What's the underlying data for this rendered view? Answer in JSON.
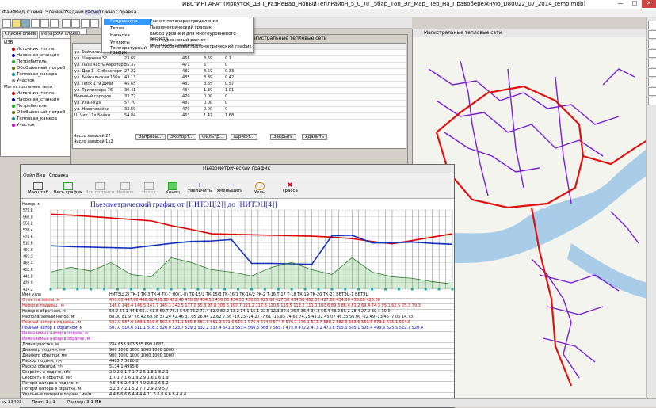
{
  "window": {
    "title": "ИВС\"ИНГАРА\" (Иркутск_ДЗП_РазНеВао_НовыйТеплРайон_5_0_ЛГ_5бар_Топ_Эл_Мар_Пер_На_Правобережную_D80022_07_2014_temp.mdb)"
  },
  "menu": [
    "Файл",
    "Вид",
    "Схема",
    "Элемент",
    "Задачи",
    "Расчет",
    "Окно",
    "Справка"
  ],
  "dropdown": {
    "items": [
      "Гидравлика",
      "Тепло",
      "Наладка",
      "Утилиты",
      "Температурный график"
    ],
    "submenu": [
      "Расчет потокораспределения",
      "Пьезометрический график",
      "Выбор уровней для многоуровневого расчета",
      "Многоуровневый расчет потокораспределения",
      "Многоуровневый пьезометрический график"
    ]
  },
  "leftpanel": {
    "tabs": [
      "Список слоев",
      "Иерархия слоев"
    ],
    "tree": [
      "ИЗВ",
      "Источник_тепла",
      "Насосная_станция",
      "Потребитель",
      "Обобщенный_потреб",
      "Тепловая_камера",
      "Участок",
      "Магистральные тепл",
      "Источник_тепла",
      "Насосная_станция",
      "Потребитель",
      "Обобщенный_потреб",
      "Тепловая_камера",
      "Участок"
    ]
  },
  "tablewin": {
    "title": "Магистральные тепловые сети",
    "rows": [
      [
        "ул. Байкальская 235",
        "10.62",
        "483",
        "3.81",
        "2.67"
      ],
      [
        "ул. Ширяева 32",
        "23.69",
        "468",
        "3.69",
        "0.1"
      ],
      [
        "ул. Лазо часть Аэропорт",
        "35.37",
        "471",
        "5",
        "0"
      ],
      [
        "ул. Дор 1 - Сибэкспорт",
        "27.22",
        "482",
        "4.59",
        "0.33"
      ],
      [
        "ул. Байкальская 166а",
        "43.13",
        "485",
        "3.89",
        "0.42"
      ],
      [
        "ул. Писк 179 Дичи",
        "45.65",
        "487",
        "3.85",
        "0.57"
      ],
      [
        "ул. Трилиссера 76",
        "30.41",
        "484",
        "1.39",
        "1.01"
      ],
      [
        "Военный городок",
        "33.72",
        "470",
        "0.00",
        "0"
      ],
      [
        "ул. Улан-Удэ",
        "57.70",
        "481",
        "0.00",
        "0"
      ],
      [
        "ул. Новоторайки",
        "33.59",
        "470",
        "0.00",
        "0"
      ],
      [
        "Ш.Чит.11а Бойки",
        "54.84",
        "463",
        "1.47",
        "1.68"
      ]
    ],
    "footer": [
      "Число записей 27",
      "Число записей 1x2"
    ],
    "buttons": [
      "Запросы...",
      "Экспорт...",
      "Фильтр...",
      "Шрифт...",
      "Закрыть",
      "Удалить"
    ]
  },
  "mapwin": {
    "title": "Магистральные тепловые сети"
  },
  "piezo": {
    "title": "Пьезометрический график",
    "menu": [
      "Файл",
      "Вид",
      "Справка"
    ],
    "tools": [
      "Масштаб",
      "Весь график",
      "Все подписи",
      "Начало",
      "Назад",
      "Конец",
      "Увеличить",
      "Уменьшить",
      "Узлы",
      "Трасса"
    ],
    "chart_title": "Пьезометрический график от [НИТЭЦ[2]] до [НИТЭЦ[4]]",
    "yaxis_title": "Напор, м",
    "status": [
      "Лист: 1 / 1",
      "Размер: 3.1 МБ"
    ]
  },
  "chart_data": {
    "type": "line",
    "title": "Пьезометрический график от [НИТЭЦ[2]] до [НИТЭЦ[4]]",
    "ylabel": "Напор, м",
    "yticks": [
      579.8,
      566.0,
      552.2,
      538.4,
      524.6,
      510.8,
      497.0,
      483.2,
      469.4,
      455.6,
      441.8,
      428.0,
      414.2
    ],
    "ylim": [
      414.2,
      579.8
    ],
    "series": [
      {
        "name": "Напор в подающем",
        "color": "#e00000",
        "x": [
          0,
          5,
          10,
          15,
          20,
          25,
          30,
          35,
          40,
          45,
          50,
          55,
          60,
          65,
          70,
          75,
          80,
          85,
          90,
          95,
          100
        ],
        "values": [
          571,
          569,
          566,
          563,
          560,
          557,
          547,
          539,
          530,
          529,
          528,
          527,
          526,
          525,
          523,
          520,
          514,
          509,
          516,
          523,
          530
        ]
      },
      {
        "name": "Напор в обратном",
        "color": "#1030c0",
        "x": [
          0,
          5,
          10,
          15,
          20,
          25,
          30,
          35,
          40,
          45,
          50,
          55,
          60,
          65,
          70,
          75,
          80,
          85,
          90,
          95,
          100
        ],
        "values": [
          505,
          503,
          502,
          501,
          500,
          505,
          510,
          514,
          515,
          518,
          468,
          468,
          467,
          466,
          526,
          527,
          511,
          511,
          513,
          510,
          508
        ]
      },
      {
        "name": "Отметка земли",
        "color": "#2a7a2a",
        "x": [
          0,
          5,
          10,
          15,
          20,
          25,
          30,
          35,
          40,
          45,
          50,
          55,
          60,
          65,
          70,
          75,
          80,
          85,
          90,
          95,
          100
        ],
        "values": [
          450,
          460,
          452,
          470,
          445,
          440,
          480,
          470,
          455,
          450,
          442,
          460,
          470,
          455,
          445,
          480,
          450,
          440,
          437,
          430,
          425
        ]
      }
    ]
  },
  "piezo_table": {
    "rows": [
      {
        "label": "Имя узла",
        "values": "НИТЭЦ[2] ТК-1 ТК-3 ТК-4 ТК-7 НО(1-8) ТК-15/2 ТК-15/3 ТК-16/1 ТК-16/2 РК-2 Т-16 Т-17 Т-18 ТК-19 ТК-20 ТК-21 ВБТЭЦ-1 ВБТЭЦ"
      },
      {
        "label": "Отметка земли, м",
        "values": "450.00 447.00 446.00 439.80 452.40 450.00 434.50 450.00 434.50 430.00 425.00 427.50 434.50 452.00 427.00 434.00 430.00 425.00"
      },
      {
        "label": "Напор в подающ., м",
        "values": "146.0 140.4 146.5 147.7 145.1 142.5 177.0 55.3 95.8 105.5 107.7 121.2 117.8 120.5 119.5 113.2 111.0 100.6 89.3 86.4 81.2 69.4 74.3 95.1 62.5 75.3 79.3"
      },
      {
        "label": "Напор в обратном, м",
        "values": "58.0 47.1 44.5 66.1 61.5 69.7 76.3 54.6 76.2 71.4 82.0 82.2 13.2 14.1 15.1 22.5 12.3 30.6 36.5 36.4 34.8 56.4 48.2 55.2 28.4 27.0 39.4 30.0"
      },
      {
        "label": "Располагаемый напор, м",
        "values": "88.00 81.97 76.42 69.88 37.24 42.46 37.05 26.44 22.62 7.66 -19.23 -24.27 -7.61 -15.93 74.62 74.25 45.02 45.07 46.35 56.06 -22.49 -13.46 -7.05 14.73"
      },
      {
        "label": "Полный напор в подающ., м",
        "values": "597.0 587.6 588.1 559.6 562.6 571.1 565.8 587.6 561.3 571.6 559.1 576.4 574.0 574.6 576.1 576.1 573.7 580.2 582.9 563.6 569.5 573.1 575.1 564.8"
      },
      {
        "label": "Полный напор в обратном, м",
        "values": "507.0 510.6 511.1 516.3 526.0 523.7 529.3 532.2 537.4 541.3 553.4 566.5 568.7 565.7 475.0 472.2 473.2 473.8 505.0 505.1 508.4 499.6 525.5 522.7 520.4"
      },
      {
        "label": "Изменяемый напор в подаче, м",
        "values": ""
      },
      {
        "label": "Изменяемый напор в обратке, м",
        "values": ""
      },
      {
        "label": "Длина участка, м",
        "values": "784 658 903 535 699 1687"
      },
      {
        "label": "Диаметр подачи, мм",
        "values": "900 1000 1000 1000 1000 1000"
      },
      {
        "label": "Диаметр обратки, мм",
        "values": "900 1000 1000 1000 1000 1000"
      },
      {
        "label": "Расход подачи, т/ч",
        "values": "4485.7 5680.8"
      },
      {
        "label": "Расход обратки, т/ч",
        "values": "5134.1 4995.6"
      },
      {
        "label": "Скорость в подаче, м/с",
        "values": "2.0 2.0 1.7 1.7 2.5 1.8 1.8 2.1"
      },
      {
        "label": "Скорость в обратке, м/с",
        "values": "1.7 1.7 1.6 1.9 2.9 1.6 1.6 1.9"
      },
      {
        "label": "Потери напора в подаче, м",
        "values": "4.5 4.5 2.4 3.4 4.9 2.6 2.6 5.2"
      },
      {
        "label": "Потери напора в обратке, м",
        "values": "3.2 3.7 2.1 5.2 7.7 2.9 2.9 5.7"
      },
      {
        "label": "Удельные потери в подаче, мм/м",
        "values": "4 4 6 6 6 6 4 4 4 4 11 6 6 6 6 6 6 4 4 4"
      },
      {
        "label": "Удельные потери в обратке, мм/м",
        "values": "4 4 5 5 5 5 4 4 4 4 10 5 5 5 5 5 5 4 4 4"
      }
    ]
  },
  "statusbar": {
    "left": "sv-33403",
    "sheet": "Лист: 1 / 1",
    "size": "Размер: 3.1 МБ"
  }
}
